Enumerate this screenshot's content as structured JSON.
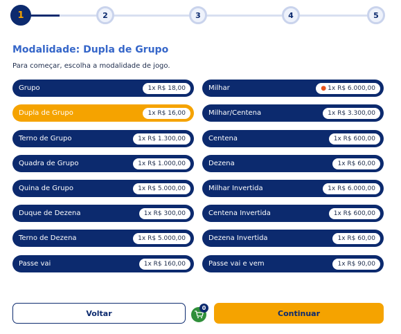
{
  "stepper": {
    "steps": [
      "1",
      "2",
      "3",
      "4",
      "5"
    ],
    "current": 1
  },
  "header": {
    "title": "Modalidade: Dupla de Grupo",
    "subtitle": "Para começar, escolha a modalidade de jogo."
  },
  "modes_left": [
    {
      "label": "Grupo",
      "price": "1x R$ 18,00"
    },
    {
      "label": "Dupla de Grupo",
      "price": "1x R$ 16,00",
      "selected": true
    },
    {
      "label": "Terno de Grupo",
      "price": "1x R$ 1.300,00"
    },
    {
      "label": "Quadra de Grupo",
      "price": "1x R$ 1.000,00"
    },
    {
      "label": "Quina de Grupo",
      "price": "1x R$ 5.000,00"
    },
    {
      "label": "Duque de Dezena",
      "price": "1x R$ 300,00"
    },
    {
      "label": "Terno de Dezena",
      "price": "1x R$ 5.000,00"
    },
    {
      "label": "Passe vai",
      "price": "1x R$ 160,00"
    }
  ],
  "modes_right": [
    {
      "label": "Milhar",
      "price": "1x R$ 6.000,00",
      "hot": true
    },
    {
      "label": "Milhar/Centena",
      "price": "1x R$ 3.300,00"
    },
    {
      "label": "Centena",
      "price": "1x R$ 600,00"
    },
    {
      "label": "Dezena",
      "price": "1x R$ 60,00"
    },
    {
      "label": "Milhar Invertida",
      "price": "1x R$ 6.000,00"
    },
    {
      "label": "Centena Invertida",
      "price": "1x R$ 600,00"
    },
    {
      "label": "Dezena Invertida",
      "price": "1x R$ 60,00"
    },
    {
      "label": "Passe vai e vem",
      "price": "1x R$ 90,00"
    }
  ],
  "footer": {
    "back_label": "Voltar",
    "continue_label": "Continuar",
    "cart_count": "0",
    "cart_icon": "cart-icon"
  },
  "colors": {
    "primary": "#0c2a6e",
    "accent": "#f5a300",
    "title": "#3566c9",
    "cart": "#2f8f3a"
  }
}
